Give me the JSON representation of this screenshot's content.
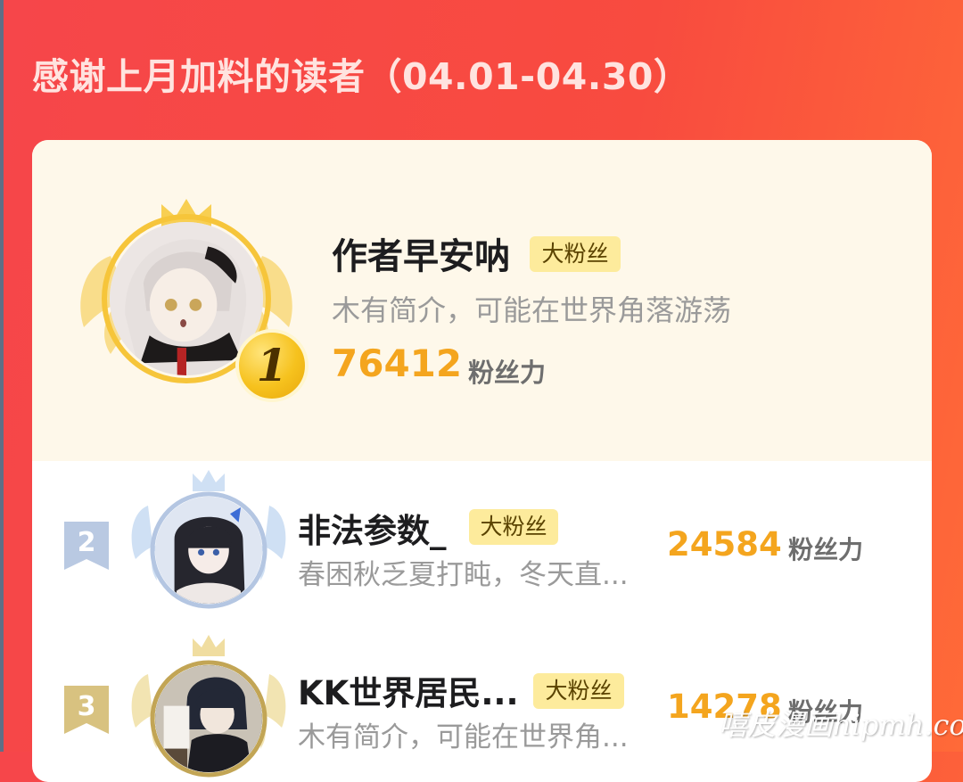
{
  "header": {
    "title": "感谢上月加料的读者（04.01-04.30）"
  },
  "colors": {
    "accent_red": "#f6464a",
    "gold": "#f4a51e",
    "badge_bg": "#fdeb9c",
    "top_bg": "#fef8ea"
  },
  "readers": [
    {
      "rank": "1",
      "name": "作者早安呐",
      "badge": "大粉丝",
      "bio": "木有简介，可能在世界角落游荡",
      "power": "76412",
      "power_unit": "粉丝力",
      "frame": "gold-crown-wings"
    },
    {
      "rank": "2",
      "name": "非法参数_",
      "badge": "大粉丝",
      "bio": "春困秋乏夏打盹，冬天直...",
      "power": "24584",
      "power_unit": "粉丝力",
      "frame": "silver-crown-wings"
    },
    {
      "rank": "3",
      "name": "KK世界居民...",
      "badge": "大粉丝",
      "bio": "木有简介，可能在世界角...",
      "power": "14278",
      "power_unit": "粉丝力",
      "frame": "bronze-crown-wings"
    }
  ],
  "watermark": "嘻皮漫画hipmh.com"
}
